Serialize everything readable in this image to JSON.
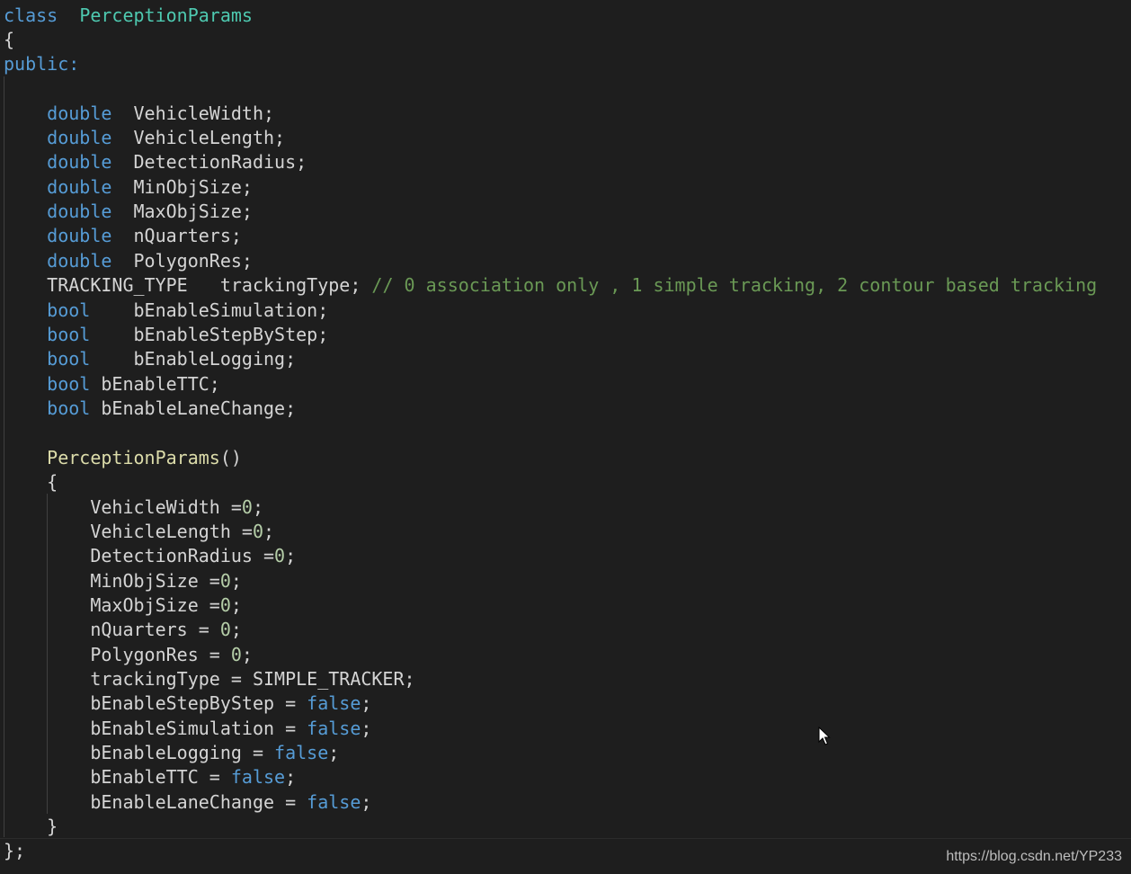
{
  "code": {
    "lines": [
      {
        "segs": [
          [
            "kw",
            "class"
          ],
          [
            "",
            "  "
          ],
          [
            "cls",
            "PerceptionParams"
          ]
        ]
      },
      {
        "segs": [
          [
            "",
            "{"
          ]
        ]
      },
      {
        "segs": [
          [
            "kw",
            "public"
          ],
          [
            "kw",
            ":"
          ]
        ]
      },
      {
        "segs": [
          [
            "",
            ""
          ]
        ]
      },
      {
        "segs": [
          [
            "",
            "    "
          ],
          [
            "kw",
            "double"
          ],
          [
            "",
            "  VehicleWidth;"
          ]
        ]
      },
      {
        "segs": [
          [
            "",
            "    "
          ],
          [
            "kw",
            "double"
          ],
          [
            "",
            "  VehicleLength;"
          ]
        ]
      },
      {
        "segs": [
          [
            "",
            "    "
          ],
          [
            "kw",
            "double"
          ],
          [
            "",
            "  DetectionRadius;"
          ]
        ]
      },
      {
        "segs": [
          [
            "",
            "    "
          ],
          [
            "kw",
            "double"
          ],
          [
            "",
            "  MinObjSize;"
          ]
        ]
      },
      {
        "segs": [
          [
            "",
            "    "
          ],
          [
            "kw",
            "double"
          ],
          [
            "",
            "  MaxObjSize;"
          ]
        ]
      },
      {
        "segs": [
          [
            "",
            "    "
          ],
          [
            "kw",
            "double"
          ],
          [
            "",
            "  nQuarters;"
          ]
        ]
      },
      {
        "segs": [
          [
            "",
            "    "
          ],
          [
            "kw",
            "double"
          ],
          [
            "",
            "  PolygonRes;"
          ]
        ]
      },
      {
        "segs": [
          [
            "",
            "    TRACKING_TYPE   trackingType; "
          ],
          [
            "cmt",
            "// 0 association only , 1 simple tracking, 2 contour based tracking"
          ]
        ]
      },
      {
        "segs": [
          [
            "",
            "    "
          ],
          [
            "kw",
            "bool"
          ],
          [
            "",
            "    bEnableSimulation;"
          ]
        ]
      },
      {
        "segs": [
          [
            "",
            "    "
          ],
          [
            "kw",
            "bool"
          ],
          [
            "",
            "    bEnableStepByStep;"
          ]
        ]
      },
      {
        "segs": [
          [
            "",
            "    "
          ],
          [
            "kw",
            "bool"
          ],
          [
            "",
            "    bEnableLogging;"
          ]
        ]
      },
      {
        "segs": [
          [
            "",
            "    "
          ],
          [
            "kw",
            "bool"
          ],
          [
            "",
            " bEnableTTC;"
          ]
        ]
      },
      {
        "segs": [
          [
            "",
            "    "
          ],
          [
            "kw",
            "bool"
          ],
          [
            "",
            " bEnableLaneChange;"
          ]
        ]
      },
      {
        "segs": [
          [
            "",
            ""
          ]
        ]
      },
      {
        "segs": [
          [
            "",
            "    "
          ],
          [
            "fn",
            "PerceptionParams"
          ],
          [
            "",
            "()"
          ]
        ]
      },
      {
        "segs": [
          [
            "",
            "    {"
          ]
        ]
      },
      {
        "segs": [
          [
            "",
            "        VehicleWidth ="
          ],
          [
            "num",
            "0"
          ],
          [
            "",
            ";"
          ]
        ]
      },
      {
        "segs": [
          [
            "",
            "        VehicleLength ="
          ],
          [
            "num",
            "0"
          ],
          [
            "",
            ";"
          ]
        ]
      },
      {
        "segs": [
          [
            "",
            "        DetectionRadius ="
          ],
          [
            "num",
            "0"
          ],
          [
            "",
            ";"
          ]
        ]
      },
      {
        "segs": [
          [
            "",
            "        MinObjSize ="
          ],
          [
            "num",
            "0"
          ],
          [
            "",
            ";"
          ]
        ]
      },
      {
        "segs": [
          [
            "",
            "        MaxObjSize ="
          ],
          [
            "num",
            "0"
          ],
          [
            "",
            ";"
          ]
        ]
      },
      {
        "segs": [
          [
            "",
            "        nQuarters = "
          ],
          [
            "num",
            "0"
          ],
          [
            "",
            ";"
          ]
        ]
      },
      {
        "segs": [
          [
            "",
            "        PolygonRes = "
          ],
          [
            "num",
            "0"
          ],
          [
            "",
            ";"
          ]
        ]
      },
      {
        "segs": [
          [
            "",
            "        trackingType = SIMPLE_TRACKER;"
          ]
        ]
      },
      {
        "segs": [
          [
            "",
            "        bEnableStepByStep = "
          ],
          [
            "kw",
            "false"
          ],
          [
            "",
            ";"
          ]
        ]
      },
      {
        "segs": [
          [
            "",
            "        bEnableSimulation = "
          ],
          [
            "kw",
            "false"
          ],
          [
            "",
            ";"
          ]
        ]
      },
      {
        "segs": [
          [
            "",
            "        bEnableLogging = "
          ],
          [
            "kw",
            "false"
          ],
          [
            "",
            ";"
          ]
        ]
      },
      {
        "segs": [
          [
            "",
            "        bEnableTTC = "
          ],
          [
            "kw",
            "false"
          ],
          [
            "",
            ";"
          ]
        ]
      },
      {
        "segs": [
          [
            "",
            "        bEnableLaneChange = "
          ],
          [
            "kw",
            "false"
          ],
          [
            "",
            ";"
          ]
        ]
      },
      {
        "segs": [
          [
            "",
            "    }"
          ]
        ]
      },
      {
        "segs": [
          [
            "",
            "};"
          ]
        ]
      }
    ]
  },
  "watermark": "https://blog.csdn.net/YP233",
  "colors": {
    "background": "#1e1e1e",
    "keyword": "#569cd6",
    "class_name": "#4ec9b0",
    "function_name": "#dcdcaa",
    "number": "#b5cea8",
    "comment": "#6a9955",
    "default_text": "#d4d4d4"
  }
}
